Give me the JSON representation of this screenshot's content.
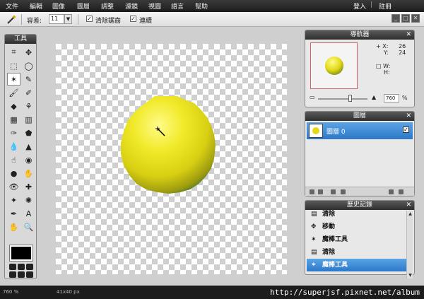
{
  "menubar": {
    "items": [
      "文件",
      "編輯",
      "圖像",
      "圖層",
      "調整",
      "濾鏡",
      "視圖",
      "語言",
      "幫助"
    ],
    "login": "登入",
    "register": "註冊",
    "sep": "|"
  },
  "options": {
    "tolerance_label": "容差:",
    "tolerance_value": "11",
    "antialias_label": "清除鋸齒",
    "contiguous_label": "連續",
    "check_mark": "✓"
  },
  "tools_panel": {
    "title": "工具",
    "icons": [
      "crop-icon",
      "move-icon",
      "marquee-icon",
      "lasso-icon",
      "magic-wand-icon",
      "pencil-icon",
      "brush-icon",
      "eraser-icon",
      "bucket-icon",
      "stamp-icon",
      "gradient-icon",
      "replace-color-icon",
      "picker-icon",
      "shapes-icon",
      "blur-icon",
      "sharpen-icon",
      "smudge-icon",
      "sponge-icon",
      "dodge-icon",
      "burn-icon",
      "redeye-icon",
      "spot-heal-icon",
      "bloat-icon",
      "pinch-icon",
      "color-picker-icon",
      "type-icon",
      "hand-icon",
      "zoom-icon"
    ],
    "glyphs": [
      "⌗",
      "✥",
      "⬚",
      "◯",
      "✶",
      "✎",
      "🖌",
      "✐",
      "◆",
      "⚘",
      "▦",
      "▥",
      "✑",
      "⬟",
      "💧",
      "▲",
      "☝",
      "◉",
      "●",
      "✋",
      "👁",
      "✚",
      "✦",
      "✺",
      "✒",
      "A",
      "✋",
      "🔍"
    ],
    "fg_color": "#000000"
  },
  "navigator": {
    "title": "導航器",
    "x_label": "X:",
    "x_value": "26",
    "y_label": "Y:",
    "y_value": "24",
    "w_label": "W:",
    "h_label": "H:",
    "zoom_value": "760",
    "zoom_unit": "%",
    "zoom_level": 0.62
  },
  "layers": {
    "title": "圖層",
    "items": [
      {
        "name": "圖層 0",
        "visible": true
      }
    ]
  },
  "history": {
    "title": "歷史記錄",
    "items": [
      {
        "label": "清除",
        "icon": "document-icon"
      },
      {
        "label": "移動",
        "icon": "move-icon"
      },
      {
        "label": "魔棒工具",
        "icon": "magic-wand-icon"
      },
      {
        "label": "清除",
        "icon": "document-icon"
      },
      {
        "label": "魔棒工具",
        "icon": "magic-wand-icon",
        "selected": true
      }
    ]
  },
  "status": {
    "zoom": "760 %",
    "size": "41x40 px",
    "url": "http://superjsf.pixnet.net/album"
  },
  "colors": {
    "accent": "#2c78c8",
    "ball_highlight": "#fffb8a",
    "ball_mid": "#e8df1a",
    "ball_dark": "#9b9a10",
    "ball_edge": "#4a7a2a"
  }
}
